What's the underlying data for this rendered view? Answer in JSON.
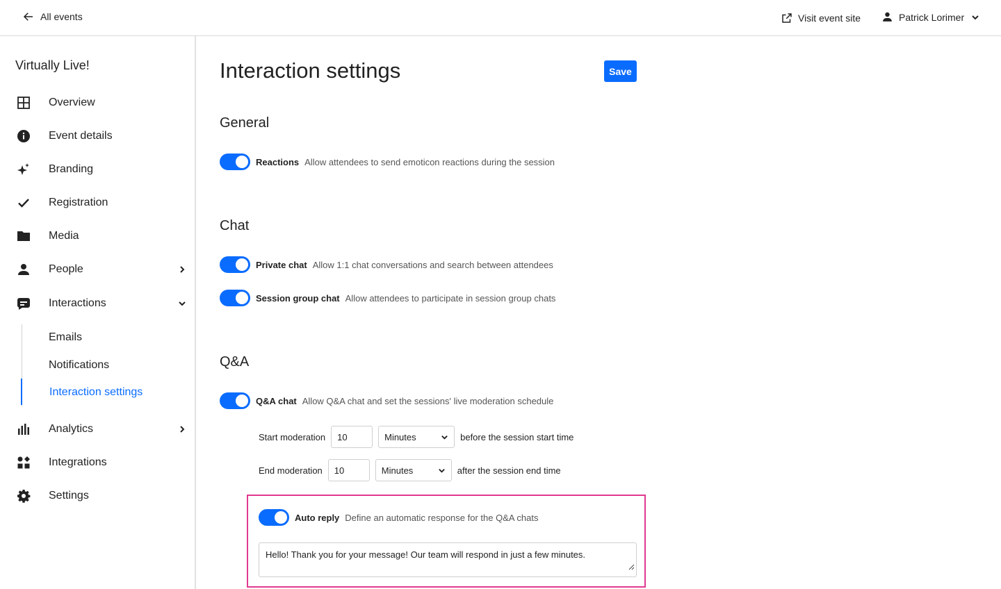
{
  "topbar": {
    "back_label": "All events",
    "visit_label": "Visit event site",
    "user_name": "Patrick Lorimer"
  },
  "sidebar": {
    "event_name": "Virtually Live!",
    "items": [
      {
        "label": "Overview",
        "icon": "grid-icon"
      },
      {
        "label": "Event details",
        "icon": "info-icon"
      },
      {
        "label": "Branding",
        "icon": "sparkle-icon"
      },
      {
        "label": "Registration",
        "icon": "check-icon"
      },
      {
        "label": "Media",
        "icon": "folder-icon"
      },
      {
        "label": "People",
        "icon": "person-icon"
      },
      {
        "label": "Interactions",
        "icon": "chat-icon"
      },
      {
        "label": "Analytics",
        "icon": "bar-chart-icon"
      },
      {
        "label": "Integrations",
        "icon": "integrations-icon"
      },
      {
        "label": "Settings",
        "icon": "gear-icon"
      }
    ],
    "sub_items": [
      {
        "label": "Emails"
      },
      {
        "label": "Notifications"
      },
      {
        "label": "Interaction settings",
        "active": true
      }
    ]
  },
  "main": {
    "title": "Interaction settings",
    "save_label": "Save",
    "sections": {
      "general": "General",
      "chat": "Chat",
      "qa": "Q&A"
    },
    "toggles": {
      "reactions": {
        "title": "Reactions",
        "desc": "Allow attendees to send emoticon reactions during the session",
        "on": true
      },
      "private_chat": {
        "title": "Private chat",
        "desc": "Allow 1:1 chat conversations and search between attendees",
        "on": true
      },
      "session_group_chat": {
        "title": "Session group chat",
        "desc": "Allow attendees to participate in session group chats",
        "on": true
      },
      "qa_chat": {
        "title": "Q&A chat",
        "desc": "Allow Q&A chat and set the sessions' live moderation schedule",
        "on": true
      },
      "auto_reply": {
        "title": "Auto reply",
        "desc": "Define an automatic response for the Q&A chats",
        "on": true
      }
    },
    "moderation": {
      "start": {
        "label": "Start moderation",
        "value": "10",
        "unit": "Minutes",
        "suffix": "before the session start time"
      },
      "end": {
        "label": "End moderation",
        "value": "10",
        "unit": "Minutes",
        "suffix": "after the session end time"
      }
    },
    "auto_reply_text": "Hello! Thank you for your message! Our team will respond in just a few minutes."
  },
  "colors": {
    "accent": "#0a6cff",
    "highlight": "#e0388f"
  }
}
